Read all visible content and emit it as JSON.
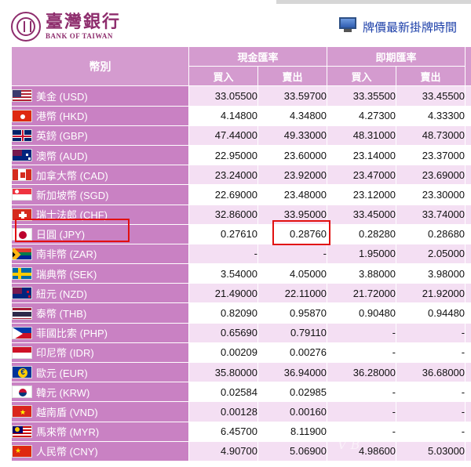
{
  "bank": {
    "name_cn": "臺灣銀行",
    "name_en": "BANK OF TAIWAN"
  },
  "header_link": {
    "icon": "monitor-icon",
    "text": "牌價最新掛牌時間"
  },
  "table": {
    "currency_header": "幣別",
    "group_headers": [
      "現金匯率",
      "即期匯率"
    ],
    "sub_headers": [
      "買入",
      "賣出",
      "買入",
      "賣出"
    ],
    "rows": [
      {
        "flag": "us",
        "name": "美金 (USD)",
        "cash_buy": "33.05500",
        "cash_sell": "33.59700",
        "spot_buy": "33.35500",
        "spot_sell": "33.45500"
      },
      {
        "flag": "hk",
        "name": "港幣 (HKD)",
        "cash_buy": "4.14800",
        "cash_sell": "4.34800",
        "spot_buy": "4.27300",
        "spot_sell": "4.33300"
      },
      {
        "flag": "gb",
        "name": "英鎊 (GBP)",
        "cash_buy": "47.44000",
        "cash_sell": "49.33000",
        "spot_buy": "48.31000",
        "spot_sell": "48.73000"
      },
      {
        "flag": "au",
        "name": "澳幣 (AUD)",
        "cash_buy": "22.95000",
        "cash_sell": "23.60000",
        "spot_buy": "23.14000",
        "spot_sell": "23.37000"
      },
      {
        "flag": "ca",
        "name": "加拿大幣 (CAD)",
        "cash_buy": "23.24000",
        "cash_sell": "23.92000",
        "spot_buy": "23.47000",
        "spot_sell": "23.69000"
      },
      {
        "flag": "sg",
        "name": "新加坡幣 (SGD)",
        "cash_buy": "22.69000",
        "cash_sell": "23.48000",
        "spot_buy": "23.12000",
        "spot_sell": "23.30000"
      },
      {
        "flag": "ch",
        "name": "瑞士法郎 (CHF)",
        "cash_buy": "32.86000",
        "cash_sell": "33.95000",
        "spot_buy": "33.45000",
        "spot_sell": "33.74000"
      },
      {
        "flag": "jp",
        "name": "日圓 (JPY)",
        "cash_buy": "0.27610",
        "cash_sell": "0.28760",
        "spot_buy": "0.28280",
        "spot_sell": "0.28680"
      },
      {
        "flag": "za",
        "name": "南非幣 (ZAR)",
        "cash_buy": "-",
        "cash_sell": "-",
        "spot_buy": "1.95000",
        "spot_sell": "2.05000"
      },
      {
        "flag": "se",
        "name": "瑞典幣 (SEK)",
        "cash_buy": "3.54000",
        "cash_sell": "4.05000",
        "spot_buy": "3.88000",
        "spot_sell": "3.98000"
      },
      {
        "flag": "nz",
        "name": "紐元 (NZD)",
        "cash_buy": "21.49000",
        "cash_sell": "22.11000",
        "spot_buy": "21.72000",
        "spot_sell": "21.92000"
      },
      {
        "flag": "th",
        "name": "泰幣 (THB)",
        "cash_buy": "0.82090",
        "cash_sell": "0.95870",
        "spot_buy": "0.90480",
        "spot_sell": "0.94480"
      },
      {
        "flag": "ph",
        "name": "菲國比索 (PHP)",
        "cash_buy": "0.65690",
        "cash_sell": "0.79110",
        "spot_buy": "-",
        "spot_sell": "-"
      },
      {
        "flag": "id",
        "name": "印尼幣 (IDR)",
        "cash_buy": "0.00209",
        "cash_sell": "0.00276",
        "spot_buy": "-",
        "spot_sell": "-"
      },
      {
        "flag": "eu",
        "name": "歐元 (EUR)",
        "cash_buy": "35.80000",
        "cash_sell": "36.94000",
        "spot_buy": "36.28000",
        "spot_sell": "36.68000"
      },
      {
        "flag": "kr",
        "name": "韓元 (KRW)",
        "cash_buy": "0.02584",
        "cash_sell": "0.02985",
        "spot_buy": "-",
        "spot_sell": "-"
      },
      {
        "flag": "vn",
        "name": "越南盾 (VND)",
        "cash_buy": "0.00128",
        "cash_sell": "0.00160",
        "spot_buy": "-",
        "spot_sell": "-"
      },
      {
        "flag": "my",
        "name": "馬來幣 (MYR)",
        "cash_buy": "6.45700",
        "cash_sell": "8.11900",
        "spot_buy": "-",
        "spot_sell": "-"
      },
      {
        "flag": "cn",
        "name": "人民幣 (CNY)",
        "cash_buy": "4.90700",
        "cash_sell": "5.06900",
        "spot_buy": "4.98600",
        "spot_sell": "5.03000"
      }
    ]
  },
  "colors": {
    "header_bg": "#d49bcf",
    "currency_cell_bg": "#c981c3",
    "odd_row_bg": "#f4dff3",
    "highlight_border": "#e11010",
    "link_color": "#1b3ea8"
  }
}
